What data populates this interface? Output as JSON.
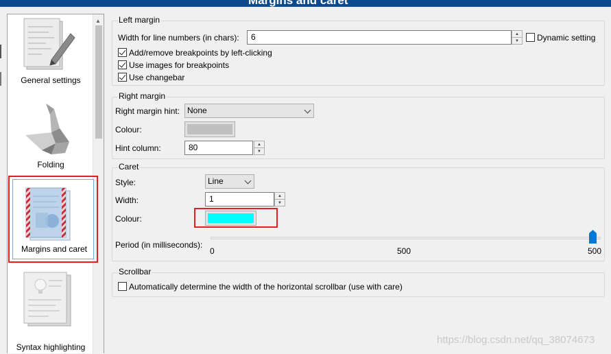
{
  "window": {
    "title": "Margins and caret"
  },
  "sidebar": {
    "items": [
      {
        "label": "General settings",
        "icon": "document-pencil-icon"
      },
      {
        "label": "Folding",
        "icon": "origami-bird-icon"
      },
      {
        "label": "Margins and caret",
        "icon": "margins-page-icon",
        "selected": true
      },
      {
        "label": "Syntax highlighting",
        "icon": "lightbulb-page-icon"
      }
    ]
  },
  "left_margin": {
    "title": "Left margin",
    "line_numbers_label": "Width for line numbers (in chars):",
    "line_numbers_value": "6",
    "dynamic_setting_label": "Dynamic setting",
    "dynamic_setting_checked": false,
    "breakpoints_click_label": "Add/remove breakpoints by left-clicking",
    "breakpoints_click_checked": true,
    "breakpoint_images_label": "Use images for breakpoints",
    "breakpoint_images_checked": true,
    "changebar_label": "Use changebar",
    "changebar_checked": true
  },
  "right_margin": {
    "title": "Right margin",
    "hint_label": "Right margin hint:",
    "hint_value": "None",
    "colour_label": "Colour:",
    "colour_value": "#c0c0c0",
    "hint_column_label": "Hint column:",
    "hint_column_value": "80"
  },
  "caret": {
    "title": "Caret",
    "style_label": "Style:",
    "style_value": "Line",
    "width_label": "Width:",
    "width_value": "1",
    "colour_label": "Colour:",
    "colour_value": "#00ffff",
    "period_label": "Period (in milliseconds):",
    "period_ticks": [
      "0",
      "500",
      "500"
    ],
    "period_value_fraction": 1.0
  },
  "scrollbar": {
    "title": "Scrollbar",
    "auto_width_label": "Automatically determine the width of the horizontal scrollbar (use with care)",
    "auto_width_checked": false
  },
  "watermark": "https://blog.csdn.net/qq_38074673",
  "colors": {
    "title_bar": "#0b4a8b",
    "highlight_box": "#e02020",
    "accent": "#0078d7"
  }
}
